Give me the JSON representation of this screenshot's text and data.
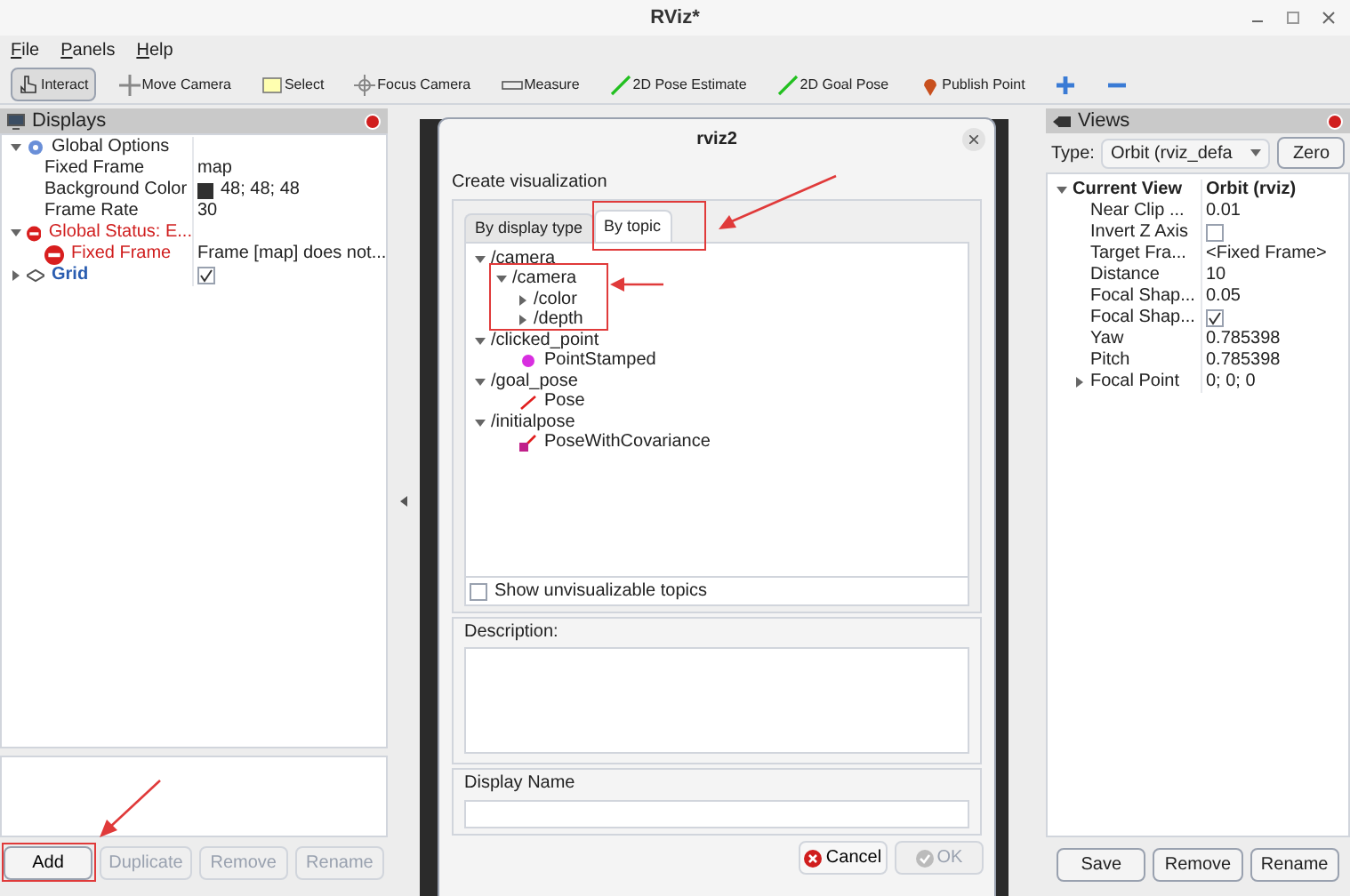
{
  "window": {
    "title": "RViz*"
  },
  "menu": [
    "File",
    "Panels",
    "Help"
  ],
  "toolbar": [
    {
      "kind": "interact",
      "label": "Interact",
      "selected": true
    },
    {
      "kind": "move",
      "label": "Move Camera",
      "selected": false
    },
    {
      "kind": "select",
      "label": "Select",
      "selected": false
    },
    {
      "kind": "focus",
      "label": "Focus Camera",
      "selected": false
    },
    {
      "kind": "measure",
      "label": "Measure",
      "selected": false
    },
    {
      "kind": "pose",
      "label": "2D Pose Estimate",
      "selected": false
    },
    {
      "kind": "pose",
      "label": "2D Goal Pose",
      "selected": false
    },
    {
      "kind": "pin",
      "label": "Publish Point",
      "selected": false
    },
    {
      "kind": "plus",
      "selected": false
    },
    {
      "kind": "minus",
      "selected": false
    }
  ],
  "displays": {
    "title": "Displays",
    "tree": [
      {
        "kind": "options",
        "name": "Global Options",
        "expanded": true,
        "children": [
          {
            "name": "Fixed Frame",
            "value": "map"
          },
          {
            "kind": "color",
            "name": "Background Color",
            "value": "48; 48; 48",
            "color": "#303030"
          },
          {
            "name": "Frame Rate",
            "value": "30"
          }
        ]
      },
      {
        "kind": "error",
        "name": "Global Status: E...",
        "expanded": true,
        "children": [
          {
            "kind": "error",
            "name": "Fixed Frame",
            "value": "Frame [map] does not..."
          }
        ]
      },
      {
        "kind": "display",
        "name": "Grid",
        "expanded": false,
        "checked": true
      }
    ],
    "buttons": [
      {
        "label": "Add",
        "disabled": false
      },
      {
        "label": "Duplicate",
        "disabled": true
      },
      {
        "label": "Remove",
        "disabled": true
      },
      {
        "label": "Rename",
        "disabled": true
      }
    ]
  },
  "dialog": {
    "title": "rviz2",
    "heading": "Create visualization",
    "tabs": [
      {
        "label": "By display type",
        "selected": false
      },
      {
        "label": "By topic",
        "selected": true
      }
    ],
    "topics": [
      {
        "kind": "topic",
        "name": "/camera",
        "expanded": true,
        "children": [
          {
            "kind": "topic",
            "name": "/camera",
            "expanded": true,
            "children": [
              {
                "kind": "topic",
                "name": "/color",
                "expanded": false
              },
              {
                "kind": "topic",
                "name": "/depth",
                "expanded": false
              }
            ]
          }
        ]
      },
      {
        "kind": "topic",
        "name": "/clicked_point",
        "expanded": true,
        "children": [
          {
            "kind": "point",
            "name": "PointStamped"
          }
        ]
      },
      {
        "kind": "topic",
        "name": "/goal_pose",
        "expanded": true,
        "children": [
          {
            "kind": "pose",
            "name": "Pose"
          }
        ]
      },
      {
        "kind": "topic",
        "name": "/initialpose",
        "expanded": true,
        "children": [
          {
            "kind": "posecov",
            "name": "PoseWithCovariance"
          }
        ]
      }
    ],
    "show_unvisualizable": {
      "label": "Show unvisualizable topics",
      "checked": false
    },
    "description_label": "Description:",
    "display_name_label": "Display Name",
    "buttons": [
      {
        "kind": "cancel",
        "label": "Cancel",
        "disabled": false
      },
      {
        "kind": "ok",
        "label": "OK",
        "disabled": true
      }
    ]
  },
  "views": {
    "title": "Views",
    "type_label": "Type:",
    "type_value": "Orbit (rviz_defa",
    "zero": "Zero",
    "tree": [
      {
        "kind": "bold",
        "name": "Current View",
        "value": "Orbit (rviz)",
        "expanded": true,
        "children": [
          {
            "name": "Near Clip ...",
            "value": "0.01"
          },
          {
            "name": "Invert Z Axis",
            "checked": false
          },
          {
            "name": "Target Fra...",
            "value": "<Fixed Frame>"
          },
          {
            "name": "Distance",
            "value": "10"
          },
          {
            "name": "Focal Shap...",
            "value": "0.05"
          },
          {
            "name": "Focal Shap...",
            "checked": true
          },
          {
            "name": "Yaw",
            "value": "0.785398"
          },
          {
            "name": "Pitch",
            "value": "0.785398"
          },
          {
            "name": "Focal Point",
            "value": "0; 0; 0",
            "expanded": false
          }
        ]
      }
    ],
    "buttons": [
      "Save",
      "Remove",
      "Rename"
    ]
  }
}
